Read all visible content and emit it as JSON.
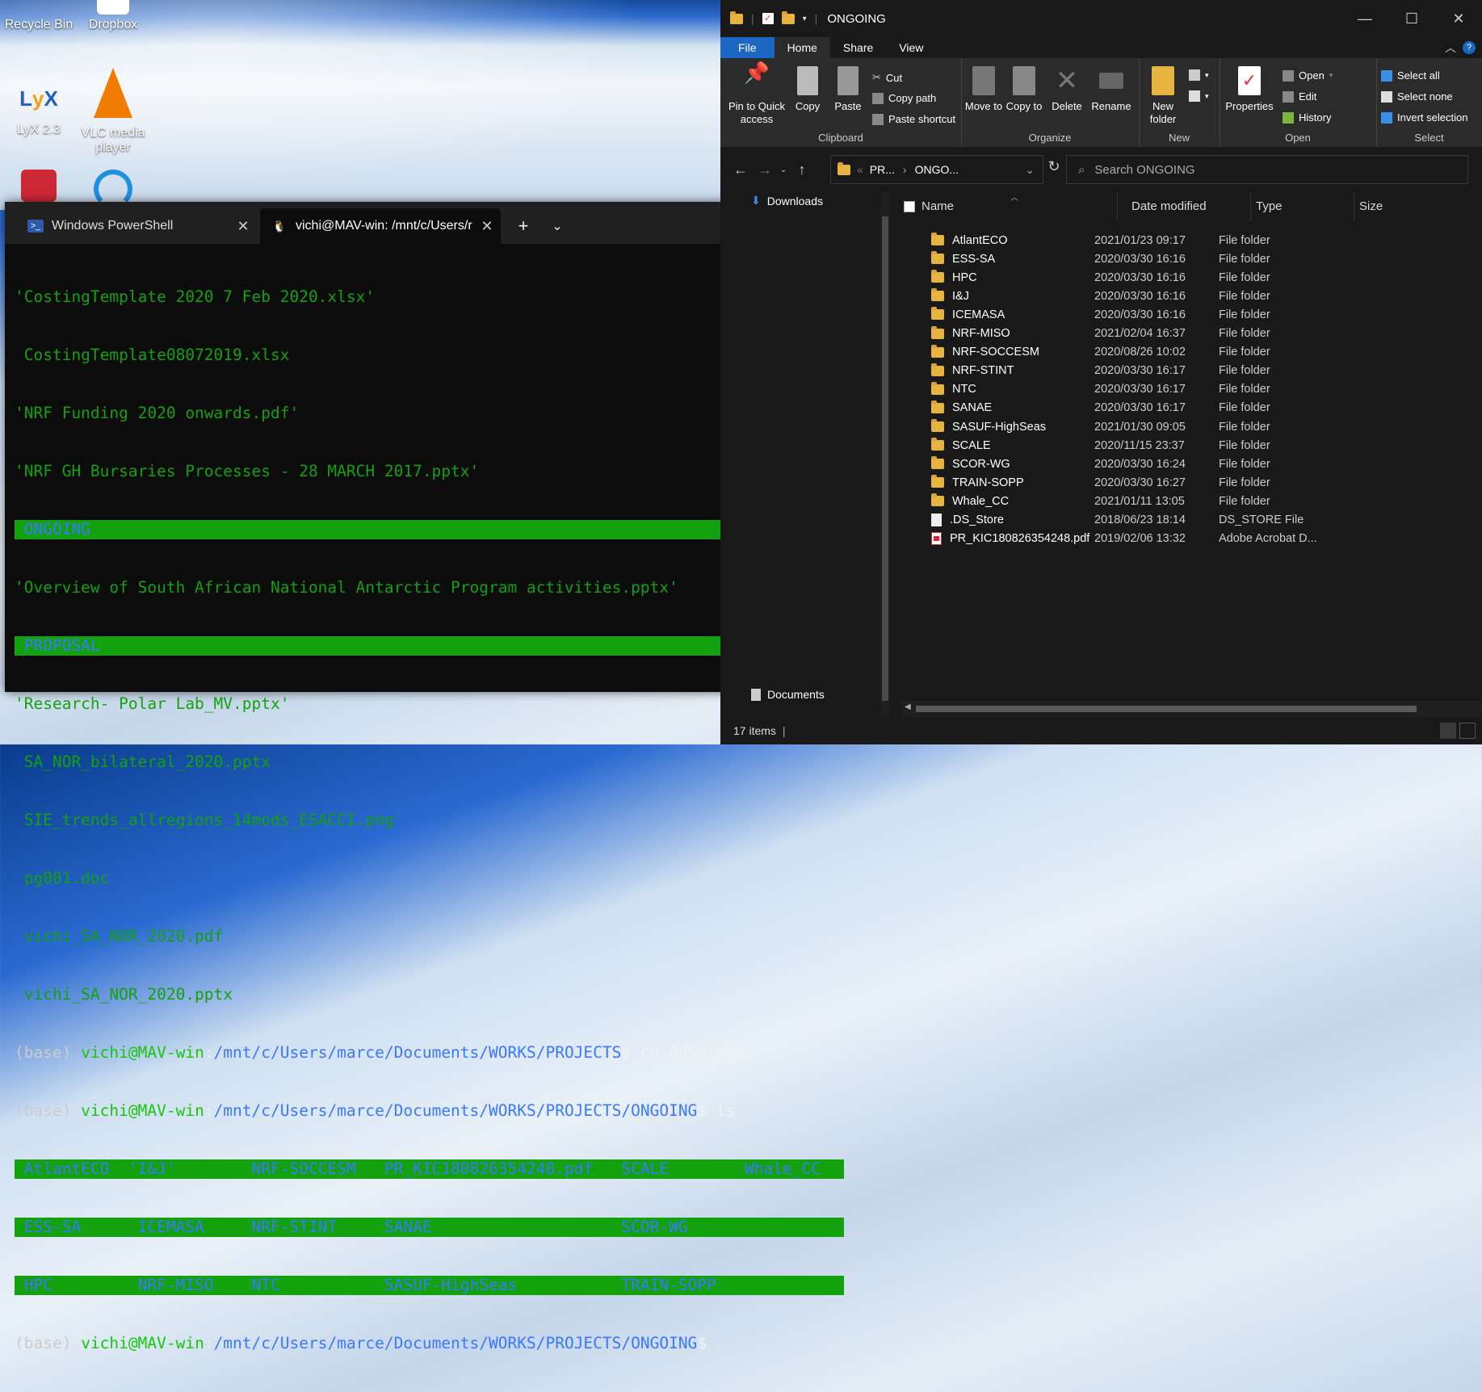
{
  "desktop": {
    "icons": [
      {
        "label": "Recycle Bin"
      },
      {
        "label": "Dropbox"
      },
      {
        "label": "LyX 2.3"
      },
      {
        "label": "VLC media player"
      }
    ]
  },
  "terminal": {
    "tabs": [
      {
        "label": "Windows PowerShell"
      },
      {
        "label": "vichi@MAV-win: /mnt/c/Users/r"
      }
    ],
    "lines": [
      "'CostingTemplate 2020 7 Feb 2020.xlsx'",
      " CostingTemplate08072019.xlsx",
      "'NRF Funding 2020 onwards.pdf'",
      "'NRF GH Bursaries Processes - 28 MARCH 2017.pptx'",
      " ONGOING",
      "'Overview of South African National Antarctic Program activities.pptx'",
      " PROPOSAL",
      "'Research- Polar Lab_MV.pptx'",
      " SA_NOR_bilateral_2020.pptx",
      " SIE_trends_allregions_14mods_ESACCI.png",
      " pg001.doc",
      " vichi_SA_NOR_2020.pdf",
      " vichi_SA_NOR_2020.pptx"
    ],
    "prompt1": {
      "base": "(base) ",
      "user": "vichi@MAV-win",
      "colon": ":",
      "path": "/mnt/c/Users/marce/Documents/WORKS/PROJECTS",
      "cmd": "$ cd ONGOING/"
    },
    "prompt2": {
      "base": "(base) ",
      "user": "vichi@MAV-win",
      "colon": ":",
      "path": "/mnt/c/Users/marce/Documents/WORKS/PROJECTS/ONGOING",
      "cmd": "$ ls"
    },
    "ls_rows": [
      " AtlantECO  'I&J'        NRF-SOCCESM   PR_KIC180826354248.pdf   SCALE        Whale_CC",
      " ESS-SA      ICEMASA     NRF-STINT     SANAE                    SCOR-WG",
      " HPC         NRF-MISO    NTC           SASUF-HighSeas           TRAIN-SOPP"
    ],
    "prompt3": {
      "base": "(base) ",
      "user": "vichi@MAV-win",
      "colon": ":",
      "path": "/mnt/c/Users/marce/Documents/WORKS/PROJECTS/ONGOING",
      "cmd": "$"
    }
  },
  "explorer": {
    "title": "ONGOING",
    "ribbon_tabs": [
      "File",
      "Home",
      "Share",
      "View"
    ],
    "clipboard": {
      "pin": "Pin to Quick access",
      "copy": "Copy",
      "paste": "Paste",
      "cut": "Cut",
      "copy_path": "Copy path",
      "paste_shortcut": "Paste shortcut",
      "label": "Clipboard"
    },
    "organize": {
      "move": "Move to",
      "copy": "Copy to",
      "delete": "Delete",
      "rename": "Rename",
      "label": "Organize"
    },
    "new": {
      "folder": "New folder",
      "label": "New"
    },
    "open": {
      "properties": "Properties",
      "open": "Open",
      "edit": "Edit",
      "history": "History",
      "label": "Open"
    },
    "select": {
      "all": "Select all",
      "none": "Select none",
      "invert": "Invert selection",
      "label": "Select"
    },
    "address": {
      "crumb1": "PR...",
      "crumb2": "ONGO..."
    },
    "search_placeholder": "Search ONGOING",
    "nav_top": "Downloads",
    "nav_bottom": "Documents",
    "columns": {
      "name": "Name",
      "date": "Date modified",
      "type": "Type",
      "size": "Size"
    },
    "rows": [
      {
        "name": "AtlantECO",
        "date": "2021/01/23 09:17",
        "type": "File folder",
        "kind": "folder"
      },
      {
        "name": "ESS-SA",
        "date": "2020/03/30 16:16",
        "type": "File folder",
        "kind": "folder"
      },
      {
        "name": "HPC",
        "date": "2020/03/30 16:16",
        "type": "File folder",
        "kind": "folder"
      },
      {
        "name": "I&J",
        "date": "2020/03/30 16:16",
        "type": "File folder",
        "kind": "folder"
      },
      {
        "name": "ICEMASA",
        "date": "2020/03/30 16:16",
        "type": "File folder",
        "kind": "folder"
      },
      {
        "name": "NRF-MISO",
        "date": "2021/02/04 16:37",
        "type": "File folder",
        "kind": "folder"
      },
      {
        "name": "NRF-SOCCESM",
        "date": "2020/08/26 10:02",
        "type": "File folder",
        "kind": "folder"
      },
      {
        "name": "NRF-STINT",
        "date": "2020/03/30 16:17",
        "type": "File folder",
        "kind": "folder"
      },
      {
        "name": "NTC",
        "date": "2020/03/30 16:17",
        "type": "File folder",
        "kind": "folder"
      },
      {
        "name": "SANAE",
        "date": "2020/03/30 16:17",
        "type": "File folder",
        "kind": "folder"
      },
      {
        "name": "SASUF-HighSeas",
        "date": "2021/01/30 09:05",
        "type": "File folder",
        "kind": "folder"
      },
      {
        "name": "SCALE",
        "date": "2020/11/15 23:37",
        "type": "File folder",
        "kind": "folder"
      },
      {
        "name": "SCOR-WG",
        "date": "2020/03/30 16:24",
        "type": "File folder",
        "kind": "folder"
      },
      {
        "name": "TRAIN-SOPP",
        "date": "2020/03/30 16:27",
        "type": "File folder",
        "kind": "folder"
      },
      {
        "name": "Whale_CC",
        "date": "2021/01/11 13:05",
        "type": "File folder",
        "kind": "folder"
      },
      {
        "name": ".DS_Store",
        "date": "2018/06/23 18:14",
        "type": "DS_STORE File",
        "kind": "file"
      },
      {
        "name": "PR_KIC180826354248.pdf",
        "date": "2019/02/06 13:32",
        "type": "Adobe Acrobat D...",
        "kind": "pdf"
      }
    ],
    "status": "17 items"
  }
}
